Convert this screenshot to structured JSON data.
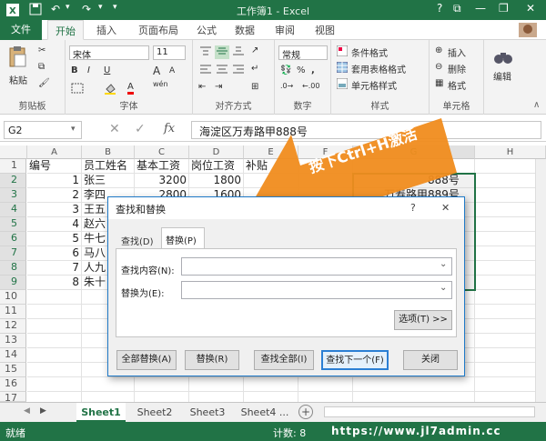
{
  "window": {
    "title": "工作簿1 - Excel",
    "help": "?",
    "minimize": "—",
    "restore": "❐",
    "close": "✕"
  },
  "tabs": [
    "文件",
    "开始",
    "插入",
    "页面布局",
    "公式",
    "数据",
    "审阅",
    "视图"
  ],
  "ribbon": {
    "clipboard": {
      "paste": "粘贴",
      "label": "剪贴板"
    },
    "font": {
      "name": "宋体",
      "size": "11",
      "bold": "B",
      "italic": "I",
      "underline": "U",
      "grow": "A",
      "shrink": "A",
      "color_a": "A",
      "wen": "wén",
      "label": "字体"
    },
    "alignment": {
      "label": "对齐方式"
    },
    "number": {
      "format": "常规",
      "percent": "%",
      "comma": ",",
      "label": "数字"
    },
    "styles": {
      "conditional": "条件格式",
      "table": "套用表格格式",
      "cell": "单元格样式",
      "label": "样式"
    },
    "cells": {
      "insert": "插入",
      "delete": "删除",
      "format": "格式",
      "label": "单元格"
    },
    "editing": {
      "label": "编辑"
    }
  },
  "formula_bar": {
    "namebox": "G2",
    "fx": "fx",
    "content": "海淀区万寿路甲888号"
  },
  "columns": [
    "A",
    "B",
    "C",
    "D",
    "E",
    "F",
    "G",
    "H"
  ],
  "rows": [
    "1",
    "2",
    "3",
    "4",
    "5",
    "6",
    "7",
    "8",
    "9",
    "10",
    "11",
    "12",
    "13",
    "14",
    "15",
    "16",
    "17"
  ],
  "cells": {
    "header": [
      "编号",
      "员工姓名",
      "基本工资",
      "岗位工资",
      "补贴"
    ],
    "ids": [
      "1",
      "2",
      "3",
      "4",
      "5",
      "6",
      "7",
      "8"
    ],
    "names": [
      "张三",
      "李四",
      "王五",
      "赵六",
      "牛七",
      "马八",
      "人九",
      "朱十"
    ],
    "base": [
      "3200",
      "2800"
    ],
    "post": [
      "1800",
      "1600"
    ],
    "g_col": [
      "888号",
      "万寿路甲889号"
    ]
  },
  "annotation": "按下Ctrl+H激活",
  "dialog": {
    "title": "查找和替换",
    "help": "?",
    "close": "✕",
    "tab_find": "查找(D)",
    "tab_replace": "替换(P)",
    "find_label": "查找内容(N):",
    "replace_label": "替换为(E):",
    "options": "选项(T) >>",
    "replace_all": "全部替换(A)",
    "replace": "替换(R)",
    "find_all": "查找全部(I)",
    "find_next": "查找下一个(F)",
    "close_btn": "关闭"
  },
  "sheets": [
    "Sheet1",
    "Sheet2",
    "Sheet3",
    "Sheet4 ..."
  ],
  "add_sheet": "+",
  "status": {
    "ready": "就绪",
    "count": "计数: 8",
    "watermark": "https://www.jl7admin.cc"
  },
  "colors": {
    "excel_green": "#217346",
    "accent_blue": "#1f7ac8",
    "arrow_orange": "#f08c1e"
  }
}
